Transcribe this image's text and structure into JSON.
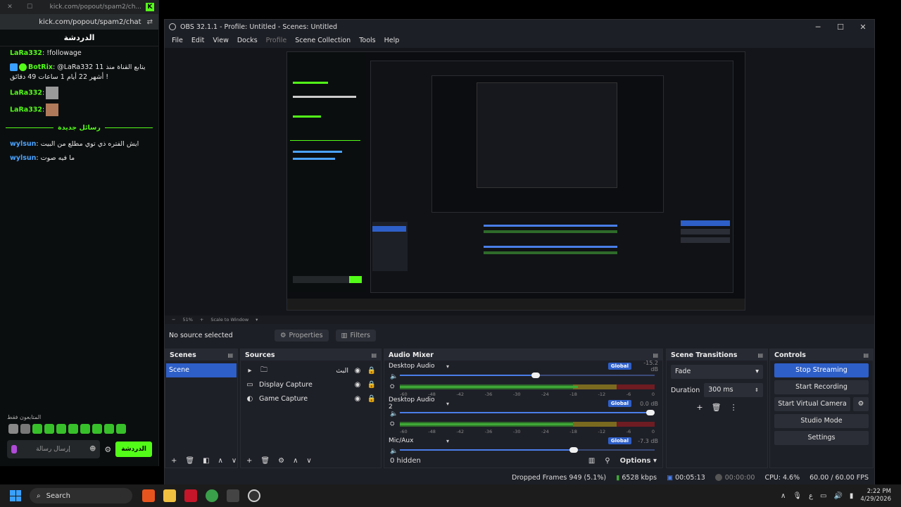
{
  "chat": {
    "tab_url": "kick.com/popout/spam2/ch...",
    "url": "kick.com/popout/spam2/chat",
    "header": "الدردشة",
    "messages": [
      {
        "user": "LaRa332",
        "text": ": !followage"
      },
      {
        "user": "BotRix",
        "text": ": @LaRa332 يتابع القناة منذ 11 أشهر 22 أيام 1 ساعات 49 دقائق !"
      },
      {
        "user": "LaRa332",
        "text": ":"
      },
      {
        "user": "LaRa332",
        "text": ":"
      }
    ],
    "new_messages_divider": "رسائل جديدة",
    "messages_after": [
      {
        "user": "wylsun",
        "text": ": ايش الفتره ذي توي مطلع من البيت"
      },
      {
        "user": "wylsun",
        "text": ": ما فيه صوت"
      }
    ],
    "followers_only": "المتابعون فقط",
    "input_placeholder": "إرسال رسالة",
    "send_label": "الدردشة"
  },
  "obs": {
    "title": "OBS 32.1.1 - Profile: Untitled - Scenes: Untitled",
    "menu": [
      "File",
      "Edit",
      "View",
      "Docks",
      "Profile",
      "Scene Collection",
      "Tools",
      "Help"
    ],
    "zoom": "51%",
    "scale_mode": "Scale to Window",
    "no_source": "No source selected",
    "properties_label": "Properties",
    "filters_label": "Filters",
    "scenes": {
      "title": "Scenes",
      "items": [
        "Scene"
      ]
    },
    "sources": {
      "title": "Sources",
      "items": [
        "البث",
        "Display Capture",
        "Game Capture"
      ]
    },
    "mixer": {
      "title": "Audio Mixer",
      "global_label": "Global",
      "channels": [
        {
          "name": "Desktop Audio",
          "db": "-15.2 dB",
          "volume": 0.55,
          "level": 0.7
        },
        {
          "name": "Desktop Audio 2",
          "db": "0.0 dB",
          "volume": 1.0,
          "level": 0.68
        },
        {
          "name": "Mic/Aux",
          "db": "-7.3 dB",
          "volume": 0.7,
          "level": 0.0
        }
      ],
      "scale": [
        "-60",
        "-48",
        "-42",
        "-36",
        "-30",
        "-24",
        "-18",
        "-12",
        "-6",
        "0"
      ],
      "hidden": "0 hidden",
      "options_label": "Options"
    },
    "transitions": {
      "title": "Scene Transitions",
      "type": "Fade",
      "duration_label": "Duration",
      "duration": "300 ms"
    },
    "controls": {
      "title": "Controls",
      "stop_streaming": "Stop Streaming",
      "start_recording": "Start Recording",
      "start_virtual_camera": "Start Virtual Camera",
      "studio_mode": "Studio Mode",
      "settings": "Settings"
    },
    "status": {
      "dropped_frames": "Dropped Frames 949 (5.1%)",
      "bitrate": "6528 kbps",
      "stream_time": "00:05:13",
      "rec_time": "00:00:00",
      "cpu": "CPU: 4.6%",
      "fps": "60.00 / 60.00 FPS"
    }
  },
  "taskbar": {
    "search": "Search",
    "time": "2:22 PM",
    "date": "4/29/2026",
    "lang": "ع"
  },
  "colors": {
    "accent": "#2e5fc8",
    "kick_green": "#53fc18"
  }
}
